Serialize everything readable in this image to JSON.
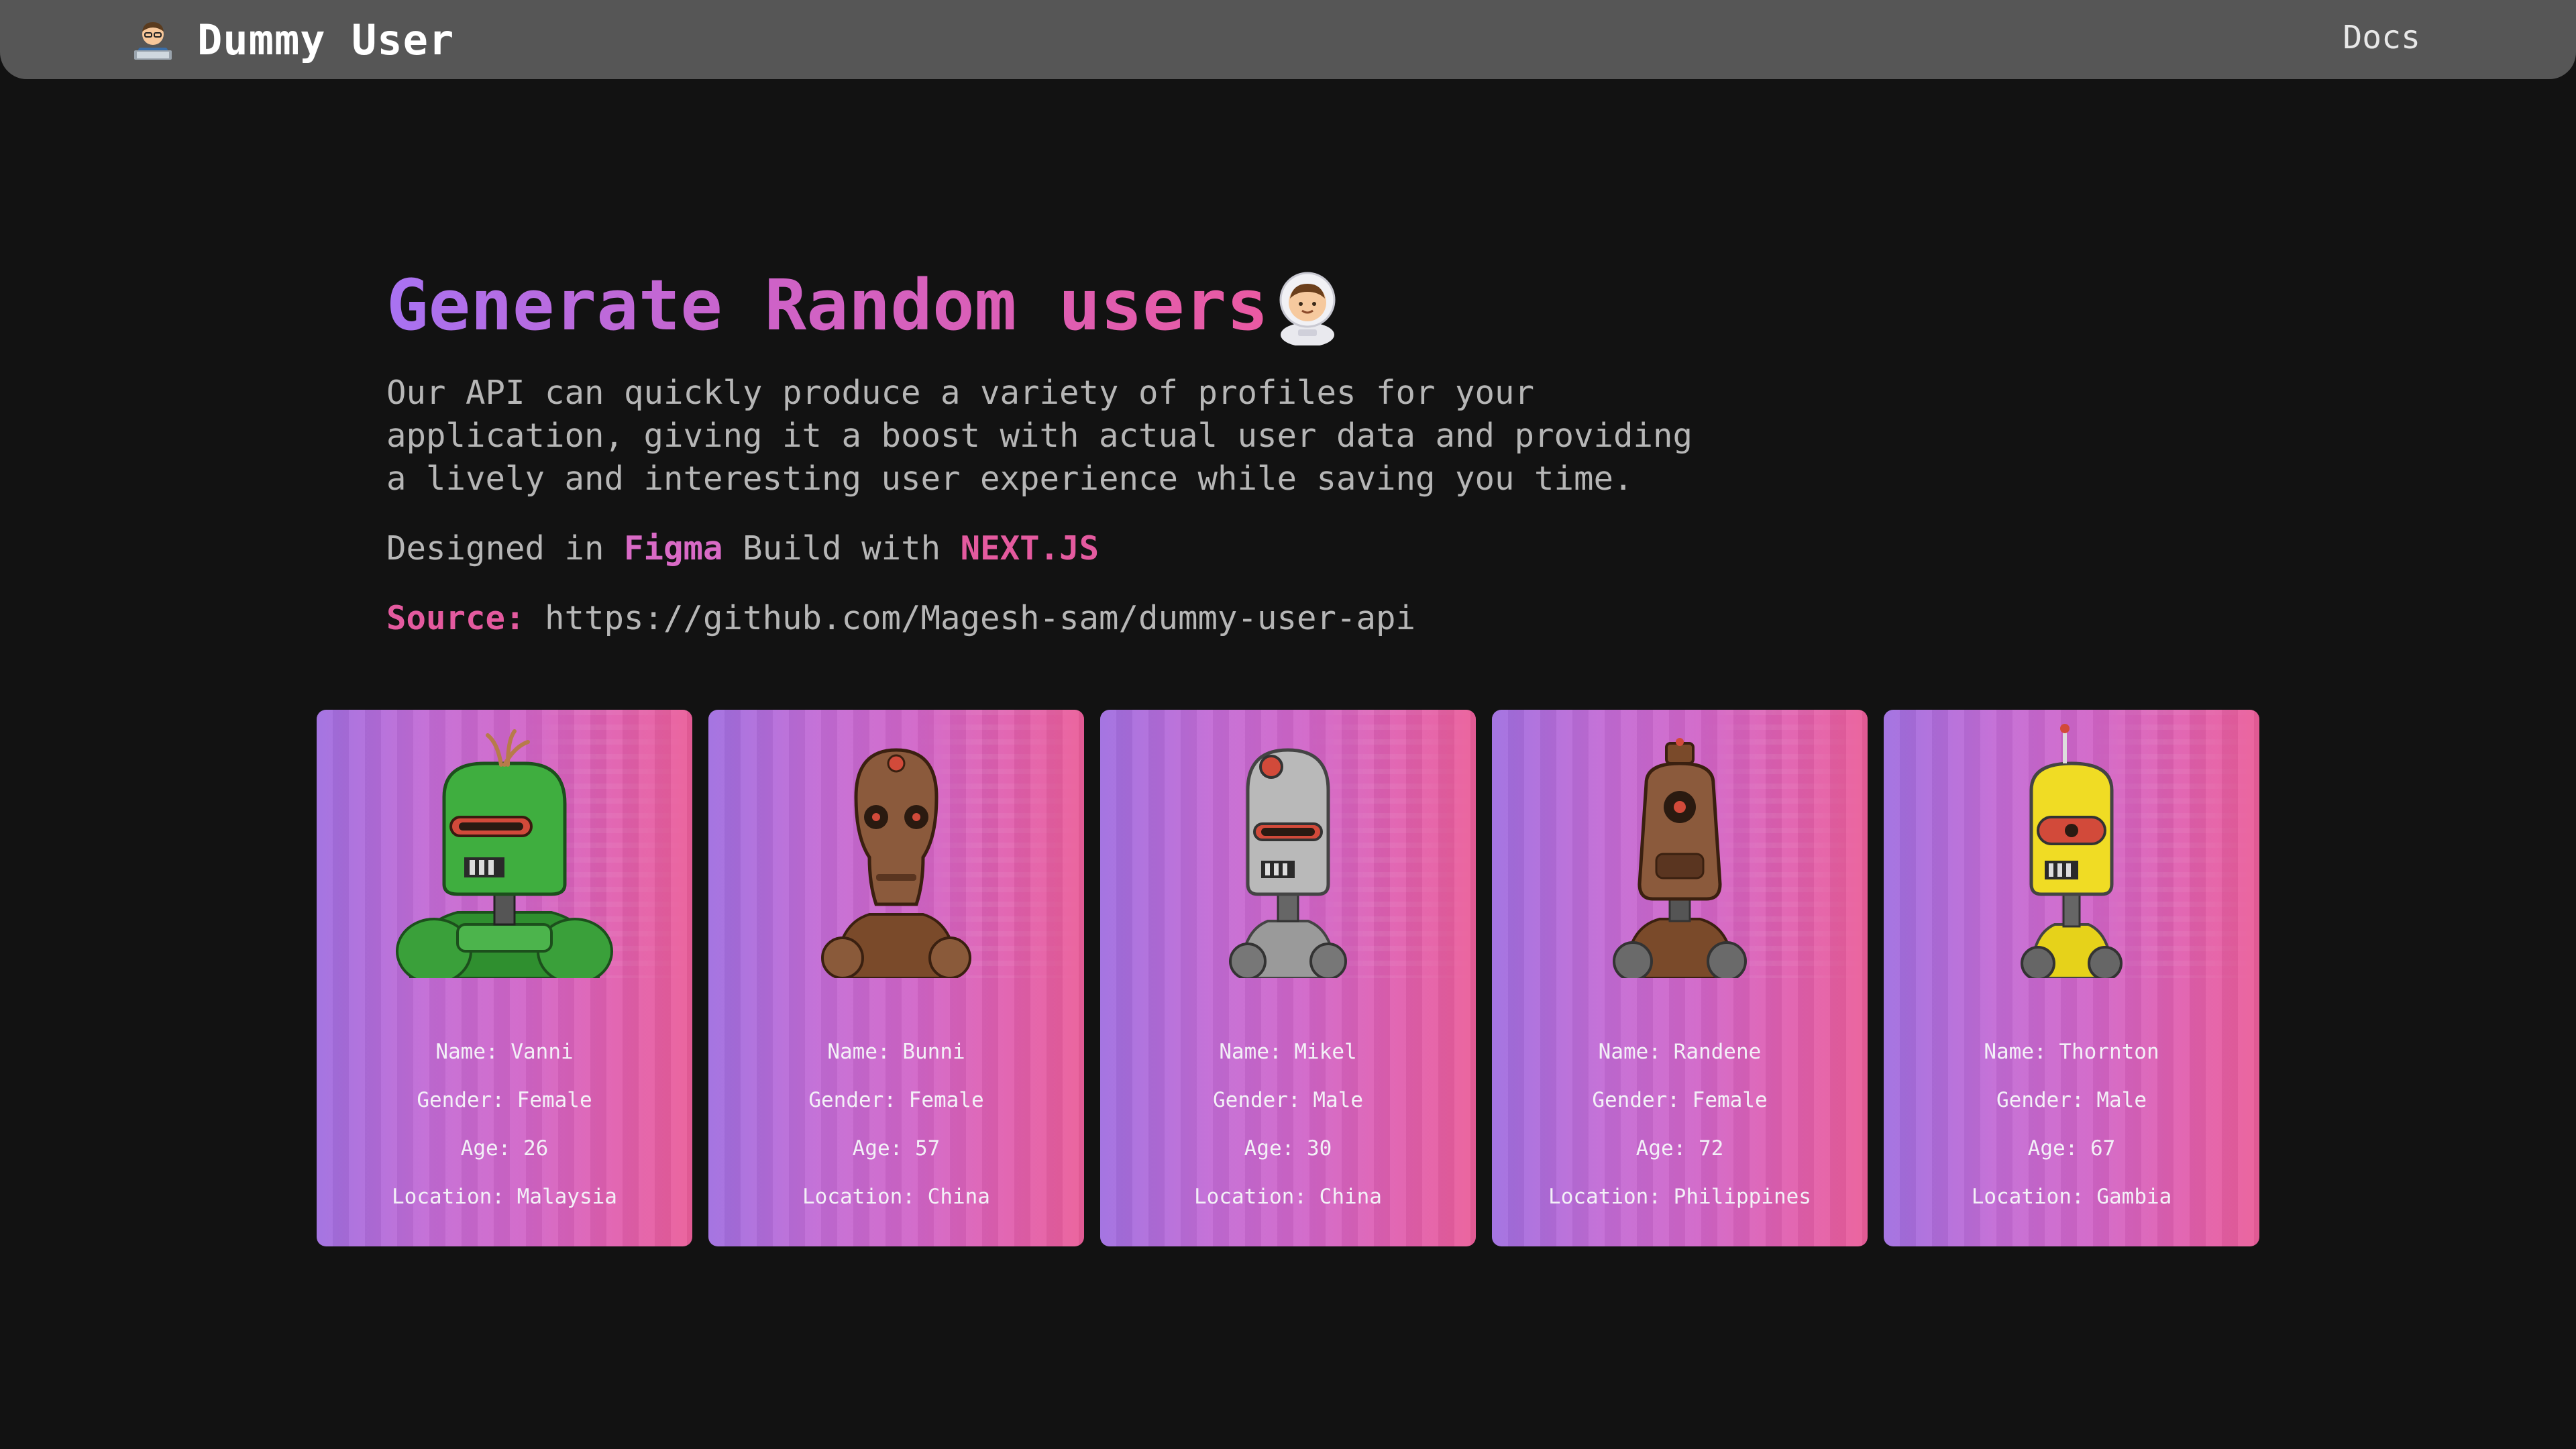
{
  "nav": {
    "brand_name": "Dummy User",
    "brand_icon": "technologist-emoji-icon",
    "docs_label": "Docs"
  },
  "hero": {
    "title": "Generate Random users",
    "title_icon": "astronaut-emoji-icon",
    "description": "Our API can quickly produce a variety of profiles for your application, giving it a boost with actual user data and providing a lively and interesting user experience while saving you time.",
    "designed_prefix": "Designed in",
    "designed_tool": "Figma",
    "build_prefix": "Build with",
    "build_tool": "NEXT.JS",
    "source_label": "Source:",
    "source_url": "https://github.com/Magesh-sam/dummy-user-api"
  },
  "colors": {
    "background": "#121212",
    "navbar": "#565656",
    "gradient_start": "#a06ee0",
    "gradient_end": "#ea5e99",
    "accent_pink": "#e45a9f",
    "accent_magenta": "#d96ac6"
  },
  "users": [
    {
      "name": "Name: Vanni",
      "gender": "Gender: Female",
      "age": "Age: 26",
      "location": "Location: Malaysia",
      "robot_color": "green"
    },
    {
      "name": "Name: Bunni",
      "gender": "Gender: Female",
      "age": "Age: 57",
      "location": "Location: China",
      "robot_color": "brown"
    },
    {
      "name": "Name: Mikel",
      "gender": "Gender: Male",
      "age": "Age: 30",
      "location": "Location: China",
      "robot_color": "gray"
    },
    {
      "name": "Name: Randene",
      "gender": "Gender: Female",
      "age": "Age: 72",
      "location": "Location: Philippines",
      "robot_color": "brown"
    },
    {
      "name": "Name: Thornton",
      "gender": "Gender: Male",
      "age": "Age: 67",
      "location": "Location: Gambia",
      "robot_color": "yellow"
    }
  ]
}
